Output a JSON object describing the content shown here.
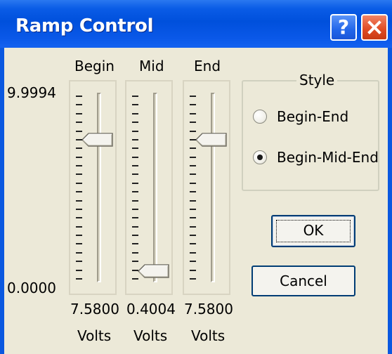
{
  "window": {
    "title": "Ramp Control",
    "help_glyph": "?",
    "title_color": "#0a58e0"
  },
  "scale": {
    "max": "9.9994",
    "min": "0.0000"
  },
  "sliders": [
    {
      "label": "Begin",
      "value": "7.5800",
      "unit": "Volts",
      "level": 0.758
    },
    {
      "label": "Mid",
      "value": "0.4004",
      "unit": "Volts",
      "level": 0.04
    },
    {
      "label": "End",
      "value": "7.5800",
      "unit": "Volts",
      "level": 0.758
    }
  ],
  "style_group": {
    "title": "Style",
    "options": [
      {
        "label": "Begin-End",
        "selected": false
      },
      {
        "label": "Begin-Mid-End",
        "selected": true
      }
    ]
  },
  "buttons": {
    "ok": "OK",
    "cancel": "Cancel"
  },
  "icons": {
    "help": "help-icon",
    "close": "close-icon",
    "thumb": "slider-thumb-icon",
    "radio": "radio-icon"
  }
}
